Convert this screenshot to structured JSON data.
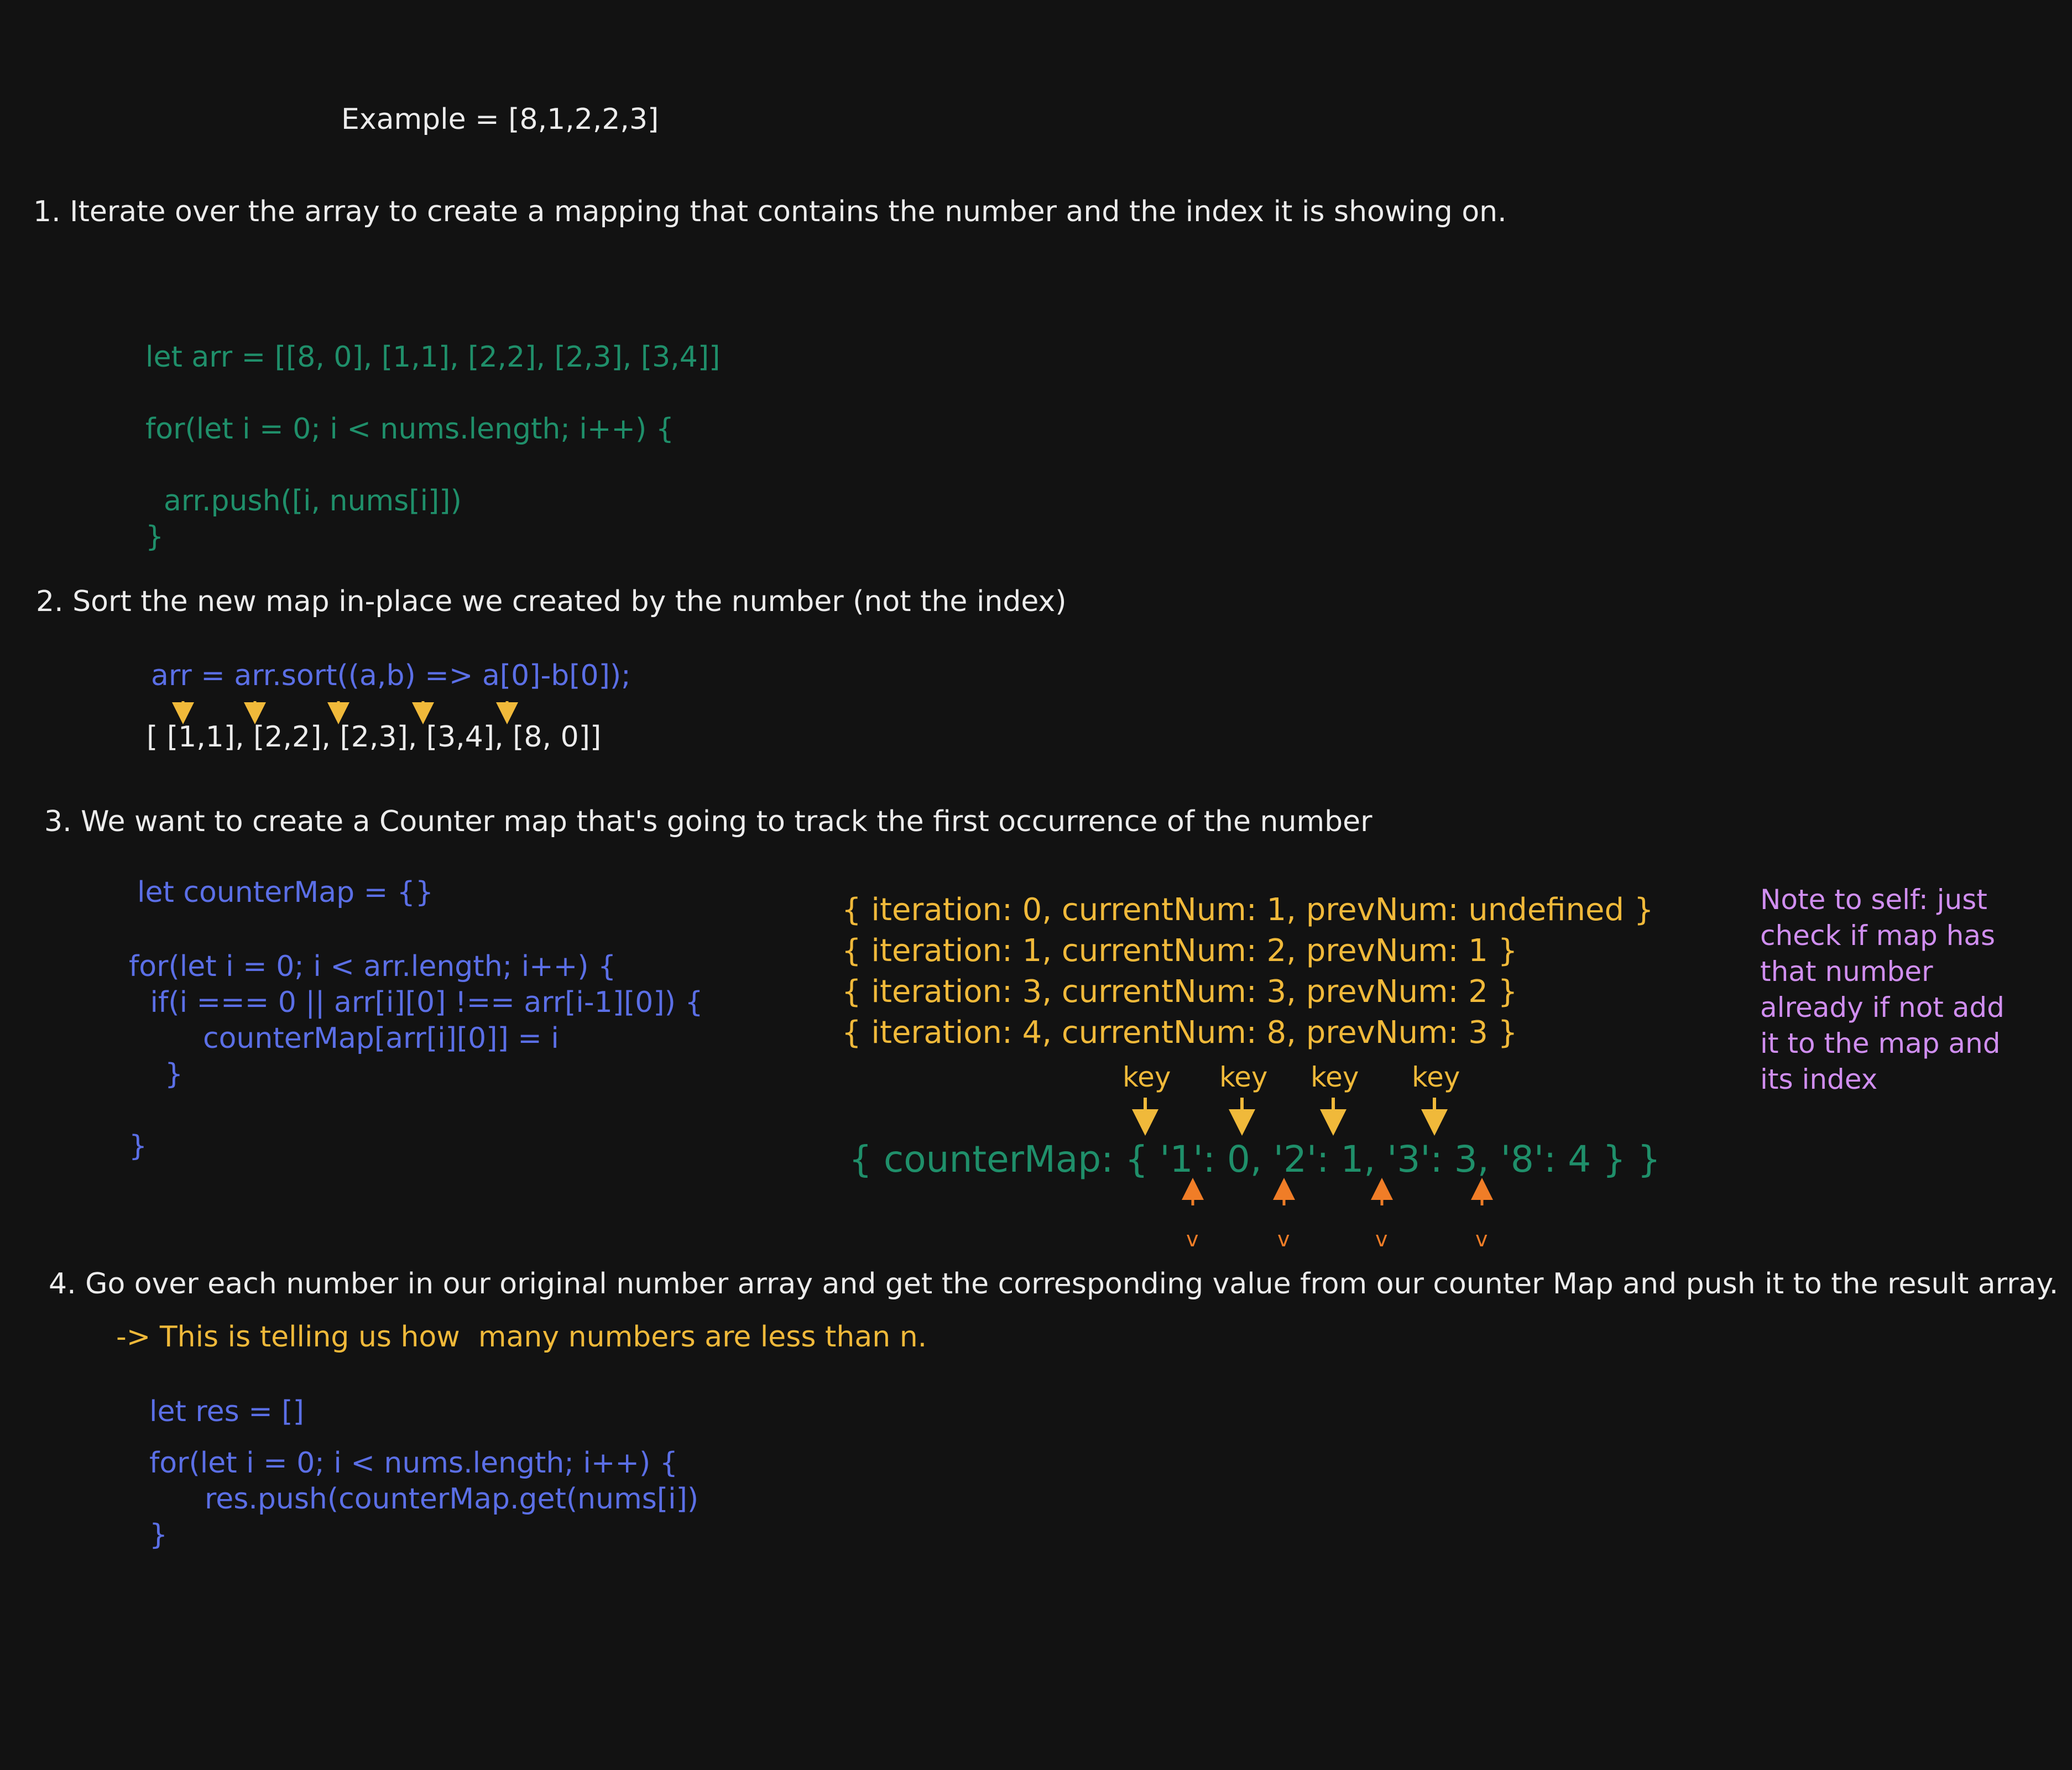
{
  "colors": {
    "background": "#121212",
    "white": "#ececec",
    "green": "#1f8f6a",
    "blue": "#5b6fe6",
    "yellow": "#f0b93a",
    "purple": "#d08ef0",
    "orange": "#f07d27"
  },
  "example": "Example = [8,1,2,2,3]",
  "step1": {
    "heading": "1. Iterate over the array to create a mapping that contains the number and the index it is showing on.",
    "code": [
      "let arr = [[8, 0], [1,1], [2,2], [2,3], [3,4]]",
      "for(let i = 0; i < nums.length; i++) {",
      "  arr.push([i, nums[i]])",
      "}"
    ]
  },
  "step2": {
    "heading": "2. Sort the new map in-place we created by the number (not the index)",
    "code": "arr = arr.sort((a,b) => a[0]-b[0]);",
    "result": "[ [1,1], [2,2], [2,3], [3,4], [8, 0]]"
  },
  "step3": {
    "heading": "3. We want to create a Counter map that's going to track the first occurrence of the number",
    "code": [
      "let counterMap = {}",
      "for(let i = 0; i < arr.length; i++) {",
      " if(i === 0 || arr[i][0] !== arr[i-1][0]) {",
      "counterMap[arr[i][0]] = i",
      "}",
      "}"
    ],
    "iterations": [
      "{ iteration: 0, currentNum: 1, prevNum: undefined }",
      "{ iteration: 1, currentNum: 2, prevNum: 1 }",
      "{ iteration: 3, currentNum: 3, prevNum: 2 }",
      "{ iteration: 4, currentNum: 8, prevNum: 3 }"
    ],
    "key_labels": [
      "key",
      "key",
      "key",
      "key"
    ],
    "counter_map": "{ counterMap: { '1': 0, '2': 1, '3': 3, '8': 4 } }",
    "value_marks": [
      "v",
      "v",
      "v",
      "v"
    ],
    "note": [
      "Note to self: just",
      "check if map has",
      "that number",
      "already if not add",
      "it to the map and",
      "its index"
    ]
  },
  "step4": {
    "heading": "4. Go over each number in our original number array and get the corresponding value from our counter Map and push it to the result array.",
    "subnote": "-> This is telling us how  many numbers are less than n.",
    "code": [
      "let res = []",
      "for(let i = 0; i < nums.length; i++) {",
      "res.push(counterMap.get(nums[i])",
      "}"
    ]
  }
}
